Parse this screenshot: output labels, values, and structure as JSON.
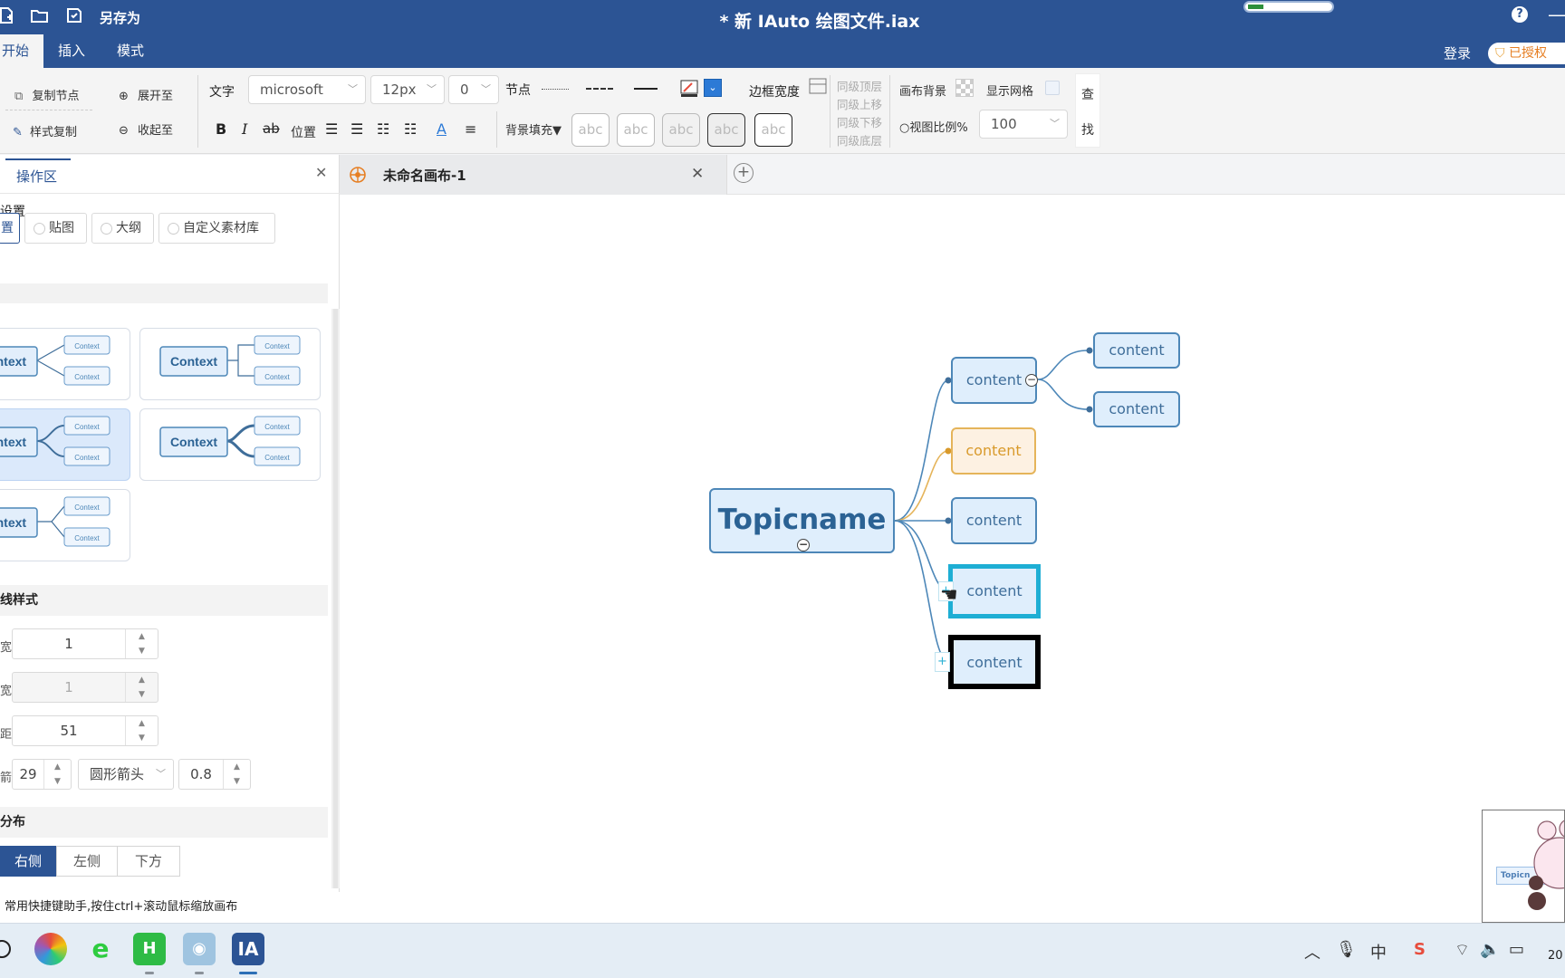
{
  "titlebar": {
    "save_as": "另存为",
    "window_title": "* 新 IAuto 绘图文件.iax",
    "memory_fraction": 0.18
  },
  "menu": {
    "tabs": [
      "开始",
      "插入",
      "模式"
    ],
    "active_tab": "开始",
    "login": "登录",
    "licensed": "已授权"
  },
  "toolbar": {
    "copy_node": "复制节点",
    "style_copy": "样式复制",
    "expand_to": "展开至",
    "collapse_to": "收起至",
    "text_label": "文字",
    "font_value": "microsoft",
    "size_value": "12px",
    "spacing_value": "0",
    "bold": "B",
    "italic": "I",
    "strike": "ab",
    "position_label": "位置",
    "font_color_glyph": "A",
    "node_label": "节点",
    "bg_fill_label": "背景填充▼",
    "abc_samples": [
      "abc",
      "abc",
      "abc",
      "abc",
      "abc"
    ],
    "border_width_label": "边框宽度",
    "layer_ops": [
      "同级顶层",
      "同级上移",
      "同级下移",
      "同级底层"
    ],
    "canvas_bg_label": "画布背景",
    "show_grid_label": "显示网格",
    "zoom_label": "视图比例%",
    "zoom_value": "100",
    "find_label_top": "查",
    "find_label_bottom": "找"
  },
  "left_panel": {
    "tab_label": "操作区",
    "settings_label": "设置",
    "mode_options": [
      "置",
      "贴图",
      "大纲",
      "自定义素材库"
    ],
    "selected_mode": "置",
    "template_word": "Context",
    "template_word_left": "ntext",
    "template_child": "Context",
    "line_style_label": "线样式",
    "line_width": "1",
    "line_width2": "1",
    "line_value3": "51",
    "arrow_size": "29",
    "arrow_type": "圆形箭头",
    "arrow_ratio": "0.8",
    "side_labels": [
      "宽",
      "宽",
      "距",
      "箭"
    ],
    "distribution_label": "分布",
    "distribution_options": [
      "右侧",
      "左侧",
      "下方"
    ],
    "selected_distribution": "右侧",
    "hint": "常用快捷键助手,按住ctrl+滚动鼠标缩放画布"
  },
  "canvas": {
    "tab_title": "未命名画布-1",
    "topic": "Topicname",
    "nodes": [
      "content",
      "content",
      "content",
      "content",
      "content"
    ],
    "sub_nodes": [
      "content",
      "content"
    ],
    "colors": {
      "node_fill": "#dfeefc",
      "node_border": "#4d87b8",
      "highlight_fill": "#fdf1e2",
      "highlight_border": "#e5b45a",
      "highlight_text": "#d99a2b",
      "selected_border": "#1eaed4",
      "black_border": "#000000",
      "link_blue": "#4d87b8",
      "link_orange": "#e5b45a"
    },
    "minimap_label": "Topicn"
  },
  "taskbar": {
    "clock": "20"
  }
}
